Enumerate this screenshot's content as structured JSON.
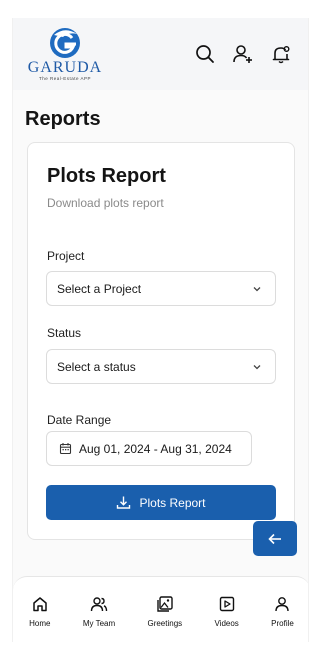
{
  "brand": {
    "name": "GARUDA",
    "tagline": "The Real-Estate APP"
  },
  "header": {
    "icons": [
      "search-icon",
      "add-user-icon",
      "notification-bell-icon"
    ]
  },
  "page": {
    "title": "Reports"
  },
  "card": {
    "title": "Plots Report",
    "subtitle": "Download plots report",
    "project": {
      "label": "Project",
      "value": "Select a Project"
    },
    "status": {
      "label": "Status",
      "value": "Select a status"
    },
    "date_range": {
      "label": "Date Range",
      "value": "Aug 01, 2024 - Aug 31, 2024"
    },
    "button_label": "Plots Report"
  },
  "nav": {
    "items": [
      {
        "label": "Home",
        "icon": "home-icon"
      },
      {
        "label": "My Team",
        "icon": "team-icon"
      },
      {
        "label": "Greetings",
        "icon": "greetings-icon"
      },
      {
        "label": "Videos",
        "icon": "videos-icon"
      },
      {
        "label": "Profile",
        "icon": "profile-icon"
      }
    ]
  },
  "colors": {
    "primary": "#1a5fad",
    "brand": "#1f5aa6",
    "muted_text": "#8a8a8a"
  }
}
